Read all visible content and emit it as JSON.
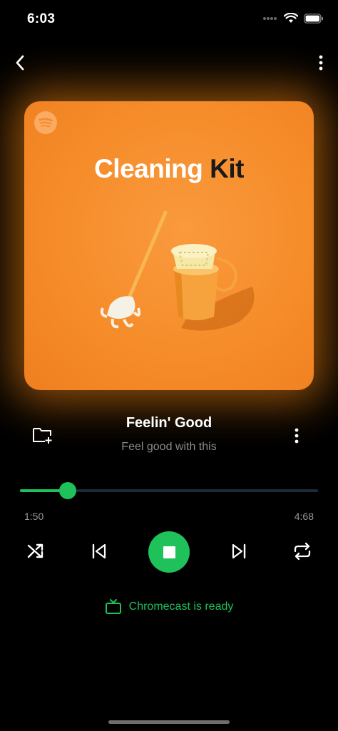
{
  "status_bar": {
    "time": "6:03"
  },
  "nav": {
    "back_icon": "chevron-left-icon",
    "more_icon": "more-vertical-icon"
  },
  "album": {
    "title_part1": "Cleaning",
    "title_part2": "Kit",
    "logo_icon": "spotify-logo-icon"
  },
  "track": {
    "title": "Feelin' Good",
    "subtitle": "Feel good with this"
  },
  "progress": {
    "elapsed": "1:50",
    "total": "4:68",
    "fraction": 0.09
  },
  "controls": {
    "shuffle_icon": "shuffle-icon",
    "previous_icon": "skip-previous-icon",
    "play_state_icon": "stop-icon",
    "next_icon": "skip-next-icon",
    "repeat_icon": "repeat-icon"
  },
  "chromecast": {
    "label": "Chromecast is ready"
  },
  "colors": {
    "accent": "#1ec15a",
    "album_bg": "#f68c2a",
    "track_bg": "#1c2b3a"
  }
}
